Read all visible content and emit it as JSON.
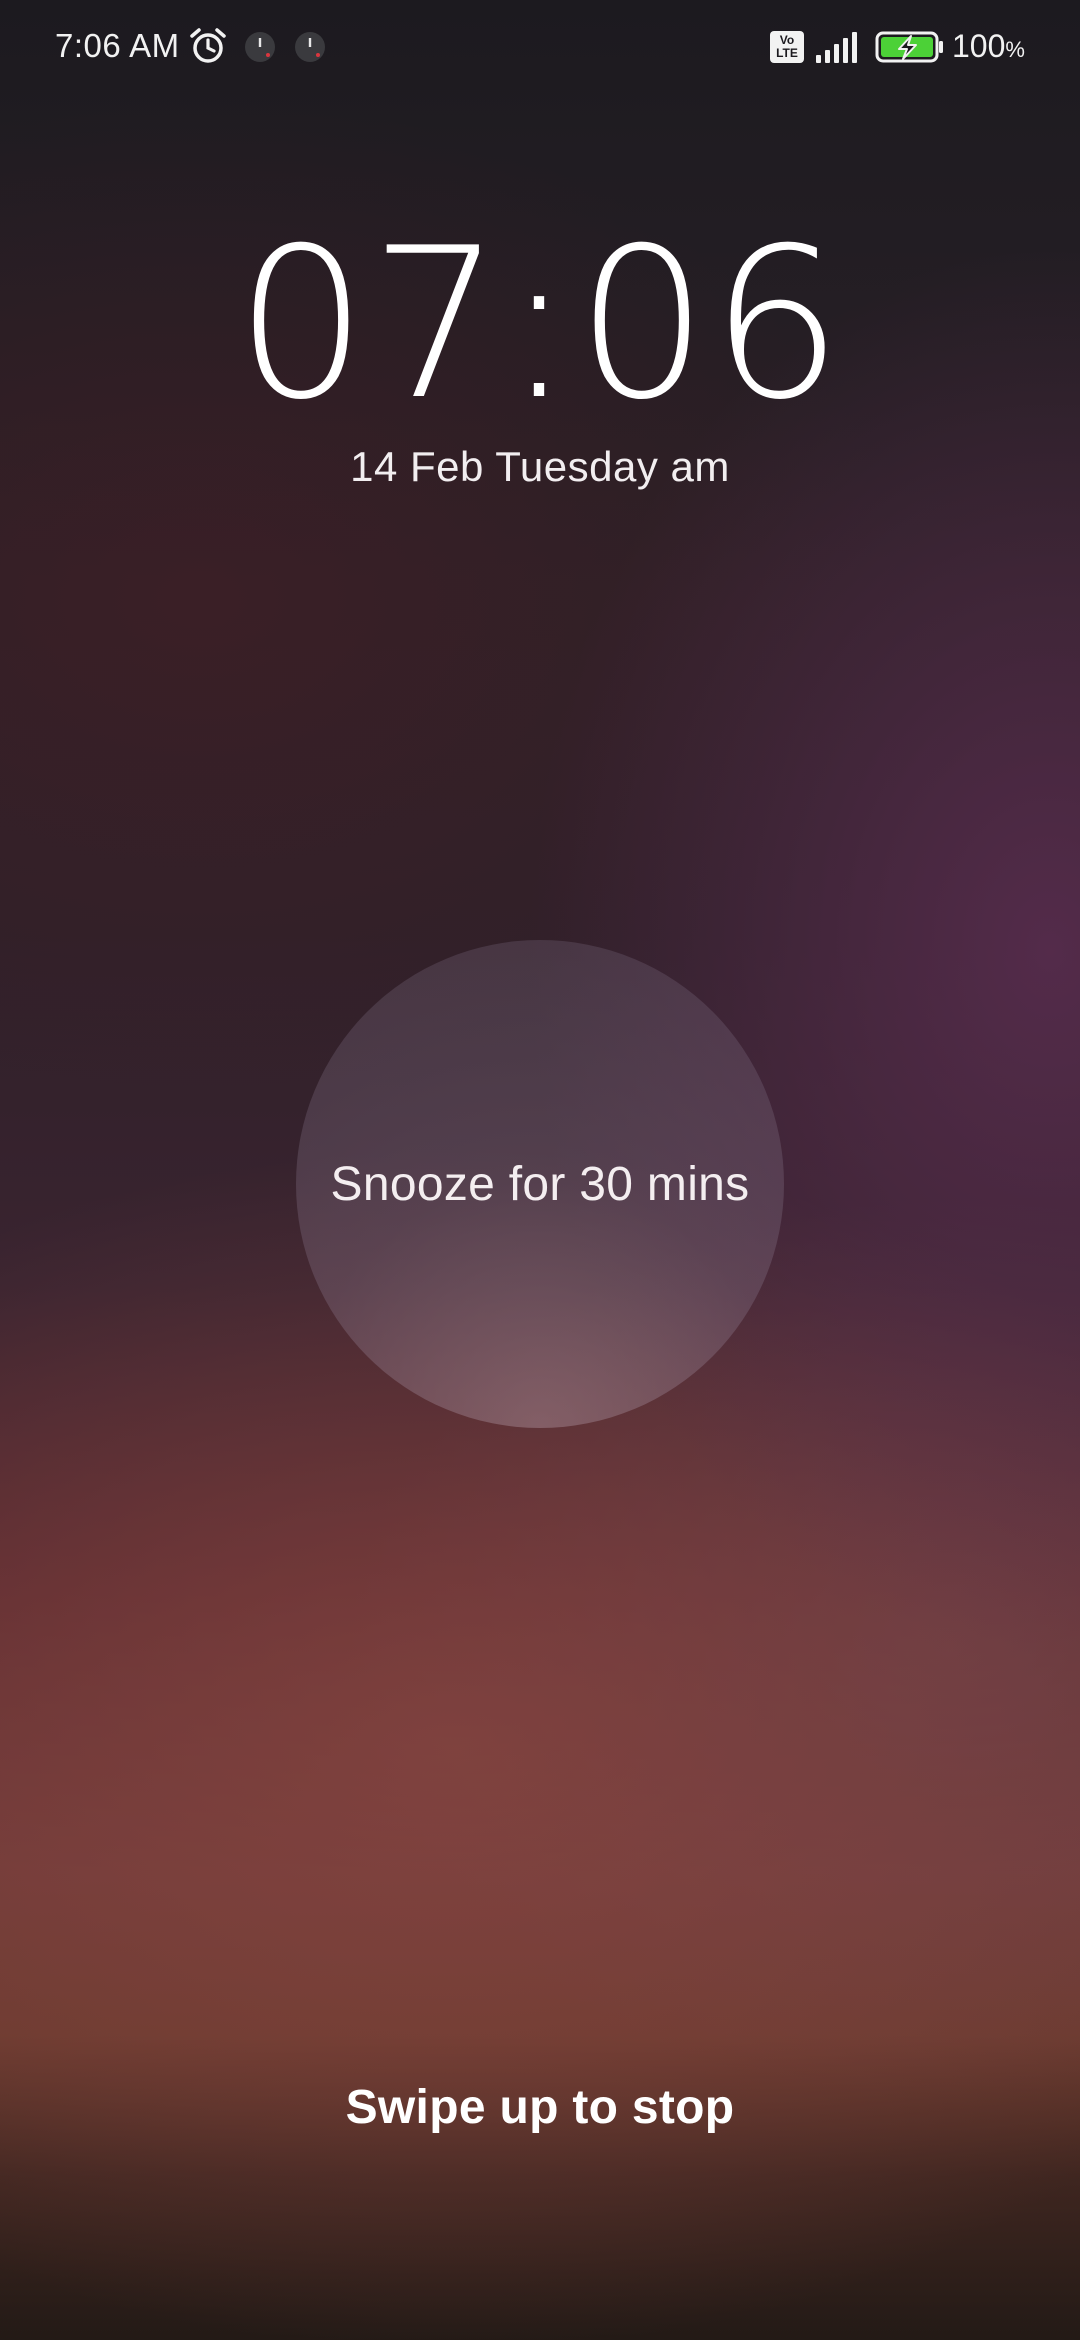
{
  "status_bar": {
    "time": "7:06 AM",
    "alarm_icon": "alarm-clock-icon",
    "notification_icons": [
      "app-notification-icon",
      "app-notification-icon"
    ],
    "network_badge": {
      "line1": "Vo",
      "line2": "LTE"
    },
    "signal_icon": "cellular-signal-icon",
    "battery_icon": "battery-charging-icon",
    "battery_value": "100",
    "battery_unit": "%"
  },
  "clock": {
    "time": "07:06",
    "date": "14 Feb Tuesday am"
  },
  "snooze": {
    "label": "Snooze for 30 mins"
  },
  "footer": {
    "swipe_label": "Swipe up to stop"
  },
  "colors": {
    "battery_fill": "#4cd137",
    "text": "#ffffff"
  }
}
